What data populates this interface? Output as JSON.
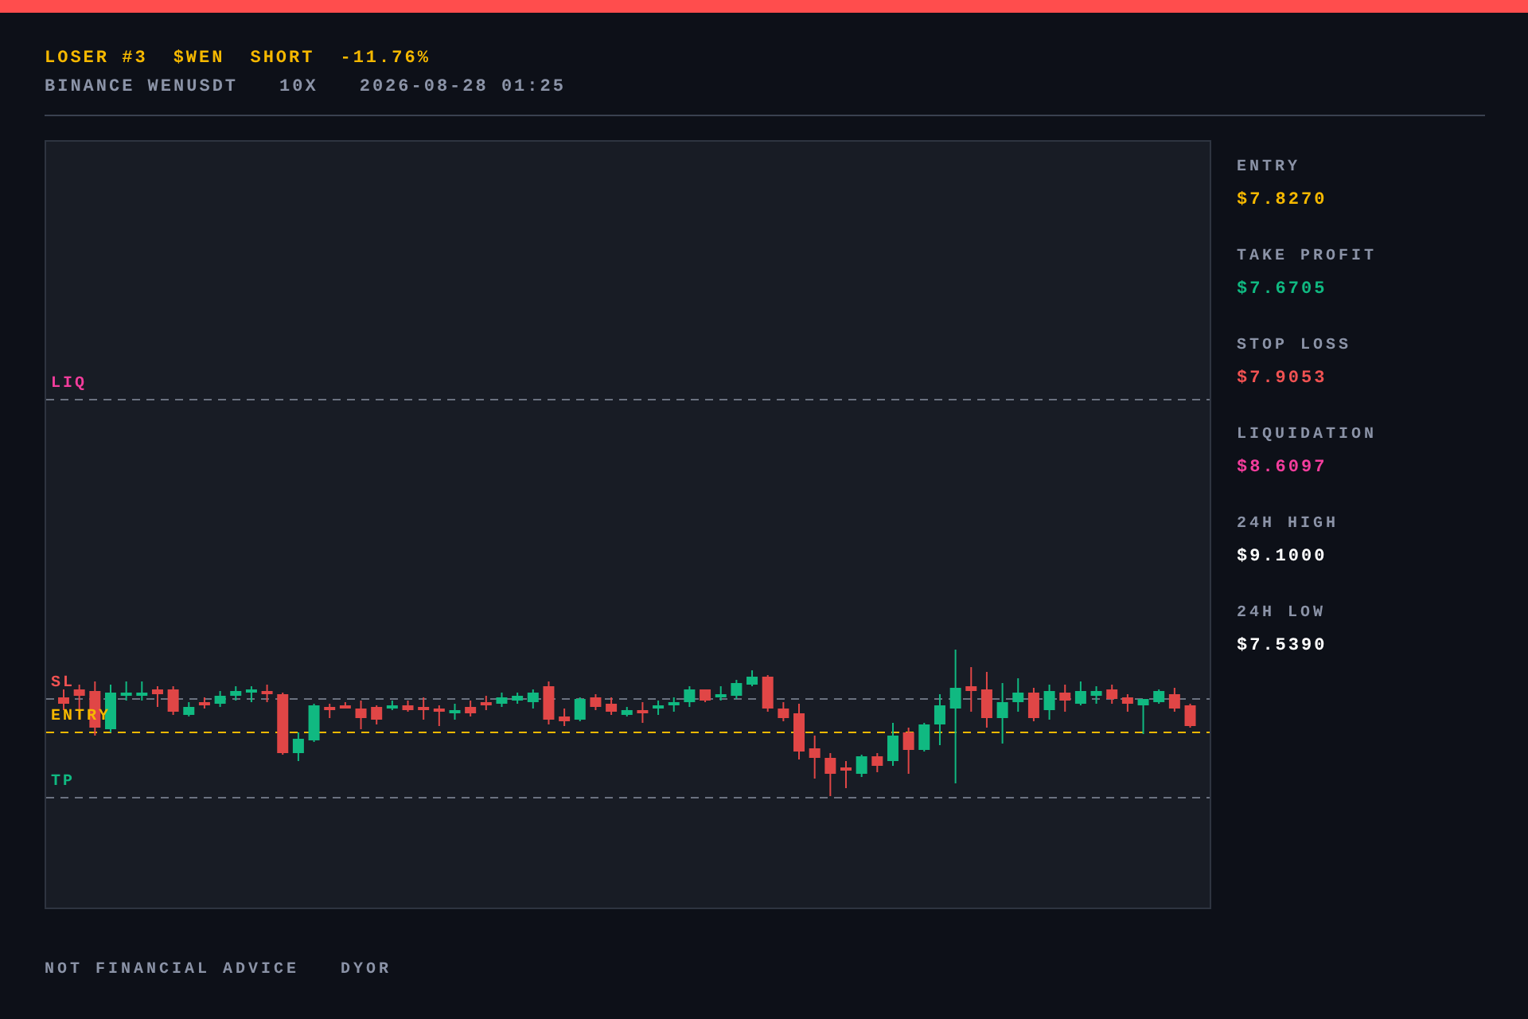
{
  "header": {
    "title_parts": [
      {
        "text": "LOSER #3",
        "kind": "highlight"
      },
      {
        "text": "$WEN",
        "kind": "highlight"
      },
      {
        "text": "SHORT",
        "kind": "highlight"
      },
      {
        "text": "-11.76%",
        "kind": "highlight"
      }
    ],
    "meta_parts": [
      "BINANCE WENUSDT",
      "10X",
      "2026-08-28 01:25"
    ]
  },
  "chart": {
    "lines": [
      {
        "label": "LIQ",
        "kind": "liq"
      },
      {
        "label": "SL",
        "kind": "sl"
      },
      {
        "label": "ENTRY",
        "kind": "entry"
      },
      {
        "label": "TP",
        "kind": "tp"
      }
    ]
  },
  "stats": [
    {
      "label": "ENTRY",
      "value": "$7.8270",
      "color": "#f5b800"
    },
    {
      "label": "TAKE PROFIT",
      "value": "$7.6705",
      "color": "#10b981"
    },
    {
      "label": "STOP LOSS",
      "value": "$7.9053",
      "color": "#f05252"
    },
    {
      "label": "LIQUIDATION",
      "value": "$8.6097",
      "color": "#f23d9c"
    },
    {
      "label": "24H HIGH",
      "value": "$9.1000",
      "color": "#ffffff"
    },
    {
      "label": "24H LOW",
      "value": "$7.5390",
      "color": "#ffffff"
    }
  ],
  "footer": [
    "NOT FINANCIAL ADVICE",
    "DYOR"
  ]
}
